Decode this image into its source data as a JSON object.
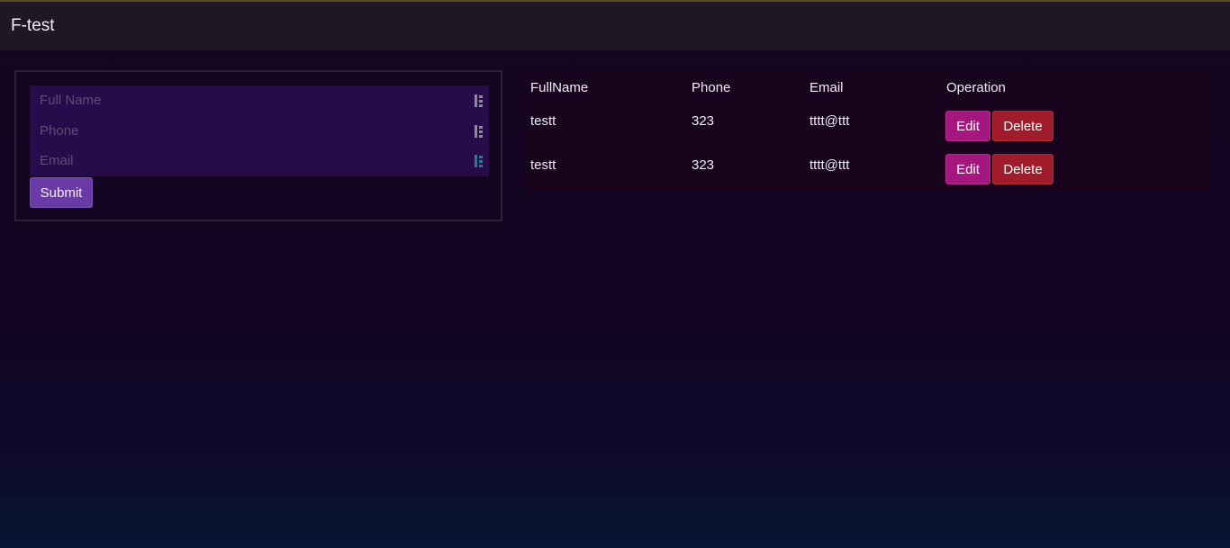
{
  "navbar": {
    "brand": "F-test"
  },
  "form": {
    "fields": [
      {
        "placeholder": "Full Name",
        "value": ""
      },
      {
        "placeholder": "Phone",
        "value": ""
      },
      {
        "placeholder": "Email",
        "value": ""
      }
    ],
    "submit_label": "Submit",
    "field_icon": "password-manager-icon"
  },
  "table": {
    "headers": [
      "FullName",
      "Phone",
      "Email",
      "Operation"
    ],
    "rows": [
      {
        "fullname": "testt",
        "phone": "323",
        "email": "tttt@ttt"
      },
      {
        "fullname": "testt",
        "phone": "323",
        "email": "tttt@ttt"
      }
    ],
    "edit_label": "Edit",
    "delete_label": "Delete"
  },
  "colors": {
    "edit_button": "#a3177f",
    "delete_button": "#a01c2a",
    "submit_button": "#6a3ba6",
    "field_background": "#260c4a"
  }
}
